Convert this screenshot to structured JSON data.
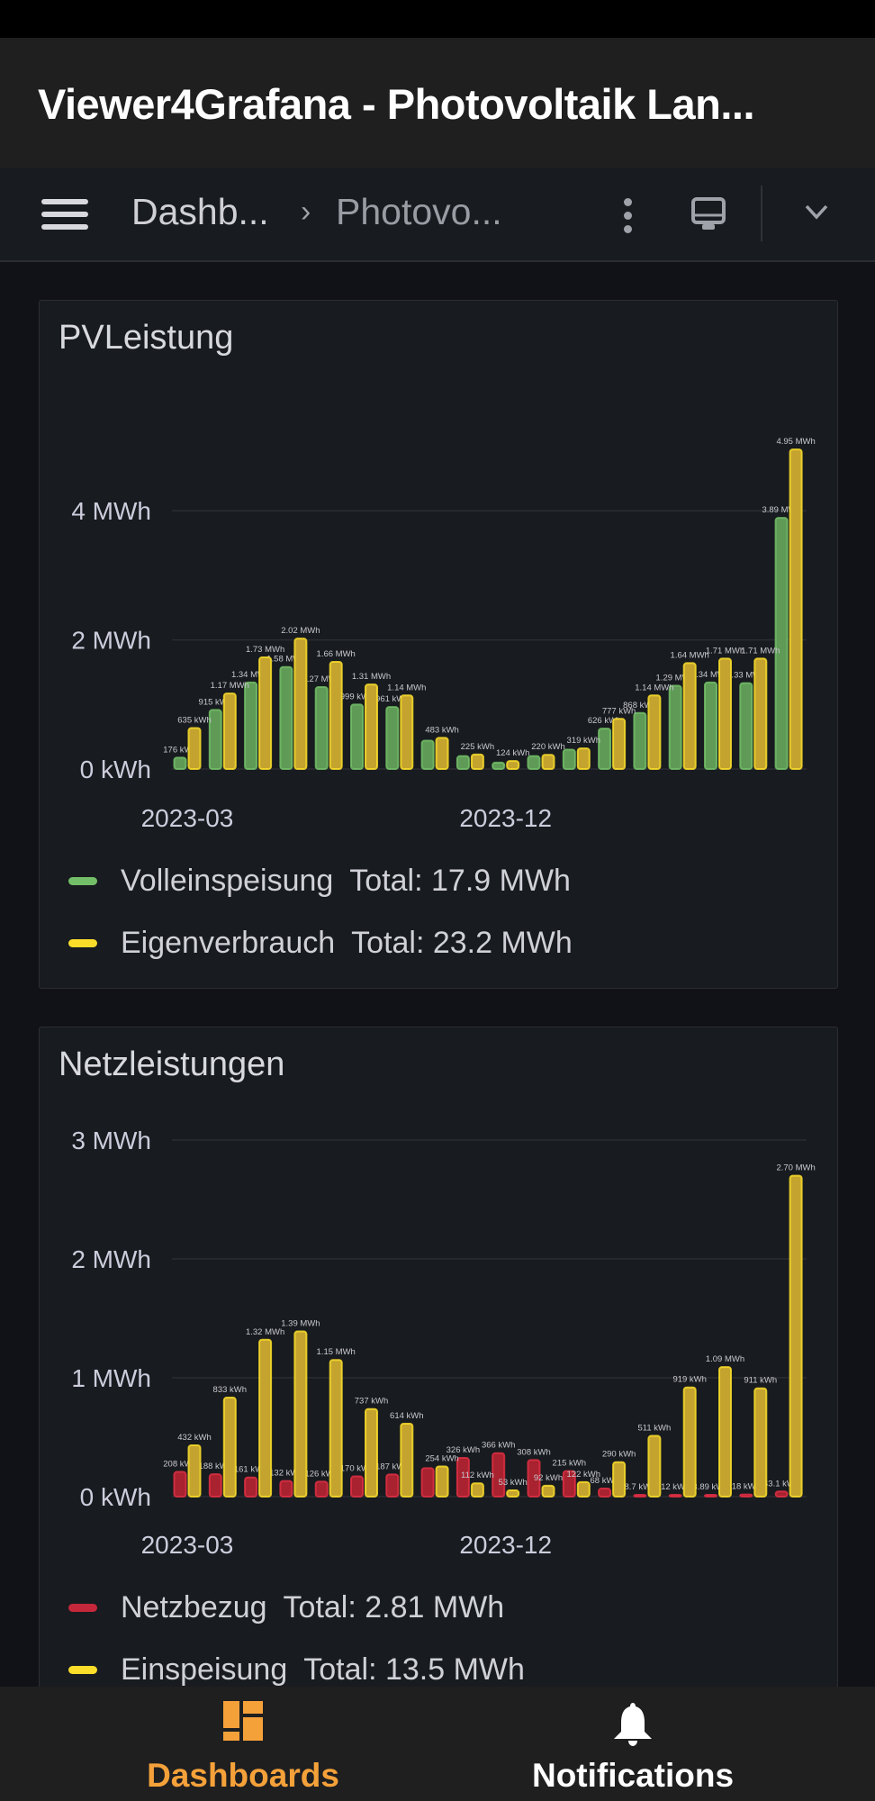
{
  "app": {
    "title": "Viewer4Grafana - Photovoltaik Lan..."
  },
  "toolbar": {
    "menu_icon": "hamburger-icon",
    "breadcrumb": [
      "Dashb...",
      "Photovo..."
    ],
    "more_icon": "kebab-icon",
    "view_icon": "tv-monitor-icon",
    "expand_icon": "chevron-down-icon"
  },
  "panels": [
    {
      "title": "PVLeistung",
      "legend": [
        {
          "name": "Volleinspeisung",
          "total": "Total: 17.9 MWh",
          "color": "#73bf69"
        },
        {
          "name": "Eigenverbrauch",
          "total": "Total: 23.2 MWh",
          "color": "#fade2a"
        }
      ]
    },
    {
      "title": "Netzleistungen",
      "legend": [
        {
          "name": "Netzbezug",
          "total": "Total: 2.81 MWh",
          "color": "#e02f44"
        },
        {
          "name": "Einspeisung",
          "total": "Total: 13.5 MWh",
          "color": "#fade2a"
        }
      ]
    }
  ],
  "chart_data": [
    {
      "type": "bar",
      "title": "PVLeistung",
      "y_ticks": [
        "0 kWh",
        "2 MWh",
        "4 MWh"
      ],
      "y_tick_values": [
        0,
        2,
        4
      ],
      "ylim": [
        0,
        5.2
      ],
      "unit": "MWh",
      "grid": true,
      "legend_placement": "bottom",
      "x_ticks": [
        {
          "index": 0,
          "label": "2023-03"
        },
        {
          "index": 9,
          "label": "2023-12"
        }
      ],
      "series": [
        {
          "name": "Volleinspeisung",
          "color": "#73bf69",
          "values": [
            0.176,
            0.915,
            1.34,
            1.58,
            1.27,
            0.999,
            0.961,
            0.44,
            0.2,
            0.1,
            0.2,
            0.3,
            0.626,
            0.868,
            1.29,
            1.34,
            1.33,
            3.89
          ],
          "labels": [
            "176 kWh",
            "915 kWh",
            "1.34 MWh",
            "1.58 MWh",
            "1.27 MWh",
            "999 kWh",
            "961 kWh",
            "",
            "",
            "",
            "",
            "",
            "626 kWh",
            "868 kWh",
            "1.29 MWh",
            "1.34 MWh",
            "1.33 MWh",
            "3.89 MWh"
          ]
        },
        {
          "name": "Eigenverbrauch",
          "color": "#fade2a",
          "values": [
            0.635,
            1.17,
            1.73,
            2.02,
            1.66,
            1.31,
            1.14,
            0.483,
            0.225,
            0.124,
            0.22,
            0.319,
            0.777,
            1.14,
            1.64,
            1.71,
            1.71,
            4.95
          ],
          "labels": [
            "635 kWh",
            "1.17 MWh",
            "1.73 MWh",
            "2.02 MWh",
            "1.66 MWh",
            "1.31 MWh",
            "1.14 MWh",
            "483 kWh",
            "225 kWh",
            "124 kWh",
            "220 kWh",
            "319 kWh",
            "777 kWh",
            "1.14 MWh",
            "1.64 MWh",
            "1.71 MWh",
            "1.71 MWh",
            "4.95 MWh"
          ]
        }
      ]
    },
    {
      "type": "bar",
      "title": "Netzleistungen",
      "y_ticks": [
        "0 kWh",
        "1 MWh",
        "2 MWh",
        "3 MWh"
      ],
      "y_tick_values": [
        0,
        1,
        2,
        3
      ],
      "ylim": [
        0,
        3
      ],
      "unit": "MWh",
      "grid": true,
      "legend_placement": "bottom",
      "x_ticks": [
        {
          "index": 0,
          "label": "2023-03"
        },
        {
          "index": 9,
          "label": "2023-12"
        }
      ],
      "series": [
        {
          "name": "Netzbezug",
          "color": "#e02f44",
          "values": [
            0.208,
            0.188,
            0.161,
            0.132,
            0.126,
            0.17,
            0.187,
            0.24,
            0.326,
            0.366,
            0.308,
            0.215,
            0.068,
            0.0087,
            0.012,
            0.00389,
            0.018,
            0.0431
          ],
          "labels": [
            "208 kWh",
            "188 kWh",
            "161 kWh",
            "132 kWh",
            "126 kWh",
            "170 kWh",
            "187 kWh",
            "",
            "326 kWh",
            "366 kWh",
            "308 kWh",
            "215 kWh",
            "68 kWh",
            "8.7 kWh",
            "12 kWh",
            "3.89 kWh",
            "18 kWh",
            "43.1 kWh"
          ]
        },
        {
          "name": "Einspeisung",
          "color": "#fade2a",
          "values": [
            0.432,
            0.833,
            1.32,
            1.39,
            1.15,
            0.737,
            0.614,
            0.254,
            0.112,
            0.053,
            0.092,
            0.122,
            0.29,
            0.511,
            0.919,
            1.09,
            0.911,
            2.7
          ],
          "labels": [
            "432 kWh",
            "833 kWh",
            "1.32 MWh",
            "1.39 MWh",
            "1.15 MWh",
            "737 kWh",
            "614 kWh",
            "254 kWh",
            "112 kWh",
            "53 kWh",
            "92 kWh",
            "122 kWh",
            "290 kWh",
            "511 kWh",
            "919 kWh",
            "1.09 MWh",
            "911 kWh",
            "2.70 MWh"
          ]
        }
      ]
    }
  ],
  "bottom_nav": [
    {
      "label": "Dashboards",
      "icon": "dashboards-grid-icon",
      "active": true,
      "color": "#f5a13a"
    },
    {
      "label": "Notifications",
      "icon": "bell-icon",
      "active": false,
      "color": "#ffffff"
    }
  ]
}
